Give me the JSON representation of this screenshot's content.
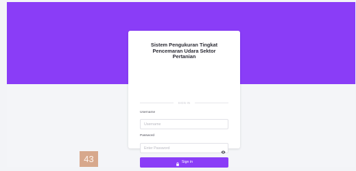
{
  "colors": {
    "primary": "#8a3df7",
    "page_background": "#f4f5f8",
    "card_background": "#ffffff",
    "badge_background": "#d7a88c"
  },
  "app": {
    "title": "Sistem Pengukuran Tingkat\nPencemaran Udara Sektor\nPertanian"
  },
  "login": {
    "divider_text": "SIGN IN",
    "username_label": "Username",
    "username_placeholder": "Username",
    "password_label": "Password",
    "password_placeholder": "Enter Password",
    "signin_label": "Sign in"
  },
  "overlay": {
    "badge_text": "43"
  },
  "icons": {
    "password_toggle": "eye-icon",
    "signin": "lock-icon"
  }
}
